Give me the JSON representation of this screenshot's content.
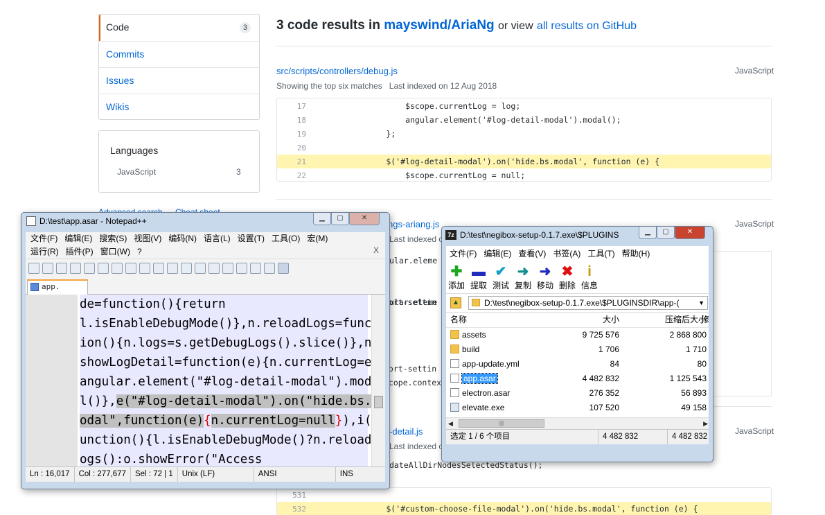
{
  "github": {
    "menu": [
      {
        "label": "Code",
        "count": "3"
      },
      {
        "label": "Commits"
      },
      {
        "label": "Issues"
      },
      {
        "label": "Wikis"
      }
    ],
    "languages_title": "Languages",
    "language": {
      "name": "JavaScript",
      "count": "3"
    },
    "advanced_search": "Advanced search",
    "cheat_sheet": "Cheat sheet",
    "results_heading_prefix": "3 code results in",
    "repo": "mayswind/AriaNg",
    "or_view": "or view",
    "all_results": "all results on GitHub",
    "result1": {
      "path": "src/scripts/controllers/debug.js",
      "lang": "JavaScript",
      "meta": "Showing the top six matches",
      "indexed": "Last indexed on 12 Aug 2018",
      "lines": [
        {
          "n": "17",
          "code": "            $scope.currentLog = log;"
        },
        {
          "n": "18",
          "code": "            angular.element('#log-detail-modal').modal();"
        },
        {
          "n": "19",
          "code": "        };"
        },
        {
          "n": "20",
          "code": ""
        },
        {
          "n": "21",
          "code": "        $('#log-detail-modal').on('hide.bs.modal', function (e) {"
        },
        {
          "n": "22",
          "code": "            $scope.currentLog = null;"
        }
      ]
    },
    "result2": {
      "path_tail": "ngs-ariang.js",
      "lang": "JavaScript",
      "indexed_tail": "Last indexed o"
    },
    "result3": {
      "path_tail": "-detail.js",
      "lang": "JavaScript",
      "indexed_tail": "Last indexed o"
    },
    "behind_fragments": [
      "ular.eleme",
      "port-settin",
      "ular.eleme",
      "port-settin",
      "scope.contex",
      "dateAllDirNodesSelectedStatus();"
    ],
    "bottom_lines": [
      {
        "n": "531",
        "code": ""
      },
      {
        "n": "532",
        "code": "        $('#custom-choose-file-modal').on('hide.bs.modal', function (e) {"
      }
    ]
  },
  "notepad": {
    "title": "D:\\test\\app.asar - Notepad++",
    "menu": [
      "文件(F)",
      "编辑(E)",
      "搜索(S)",
      "视图(V)",
      "编码(N)",
      "语言(L)",
      "设置(T)",
      "工具(O)",
      "宏(M)",
      "运行(R)",
      "插件(P)",
      "窗口(W)",
      "?"
    ],
    "close_x": "X",
    "tab": "app. asar",
    "lines": [
      "de=function(){return",
      "l.isEnableDebugMode()},n.reloadLogs=funct",
      "ion(){n.logs=s.getDebugLogs().slice()},n.",
      "showLogDetail=function(e){n.currentLog=e,",
      "angular.element(\"#log-detail-modal\").moda"
    ],
    "line6_a": "l()},",
    "line6_b": "e(\"#log-detail-modal\").on(\"hide.bs.m",
    "line7_a": "odal\",function(e)",
    "line7_brace1": "{",
    "line7_b": "n.currentLog=null",
    "line7_brace2": "}",
    "line7_c": "),i(f",
    "line8": "unction(){l.isEnableDebugMode()?n.reloadL",
    "line9": "ogs():o.showError(\"Access",
    "status": {
      "ln": "Ln : 16,017",
      "col": "Col : 277,677",
      "sel": "Sel : 72 | 1",
      "eol": "Unix (LF)",
      "enc": "ANSI",
      "mode": "INS"
    }
  },
  "sevenzip": {
    "title": "D:\\test\\negibox-setup-0.1.7.exe\\$PLUGINS...",
    "menu": [
      "文件(F)",
      "编辑(E)",
      "查看(V)",
      "书签(A)",
      "工具(T)",
      "帮助(H)"
    ],
    "toolbar": [
      {
        "label": "添加",
        "icon": "add-icon",
        "glyph": "✚",
        "color": "#1ea61e"
      },
      {
        "label": "提取",
        "icon": "extract-icon",
        "glyph": "▬",
        "color": "#1f2bbd"
      },
      {
        "label": "测试",
        "icon": "test-icon",
        "glyph": "✔",
        "color": "#14a0c8"
      },
      {
        "label": "复制",
        "icon": "copy-icon",
        "glyph": "➜",
        "color": "#148f8f"
      },
      {
        "label": "移动",
        "icon": "move-icon",
        "glyph": "➜",
        "color": "#1f2bbd"
      },
      {
        "label": "删除",
        "icon": "delete-icon",
        "glyph": "✖",
        "color": "#e01010"
      },
      {
        "label": "信息",
        "icon": "info-icon",
        "glyph": "i",
        "color": "#c79a00"
      }
    ],
    "path": "D:\\test\\negibox-setup-0.1.7.exe\\$PLUGINSDIR\\app-(",
    "columns": [
      "名称",
      "大小",
      "压缩后大小",
      "修"
    ],
    "files": [
      {
        "name": "assets",
        "size": "9 725 576",
        "packed": "2 868 800",
        "type": "folder"
      },
      {
        "name": "build",
        "size": "1 706",
        "packed": "1 710",
        "type": "folder"
      },
      {
        "name": "app-update.yml",
        "size": "84",
        "packed": "80",
        "type": "file"
      },
      {
        "name": "app.asar",
        "size": "4 482 832",
        "packed": "1 125 543",
        "type": "file"
      },
      {
        "name": "electron.asar",
        "size": "276 352",
        "packed": "56 893",
        "type": "file"
      },
      {
        "name": "elevate.exe",
        "size": "107 520",
        "packed": "49 158",
        "type": "exe"
      }
    ],
    "status": {
      "selected": "选定 1 / 6 个项目",
      "size": "4 482 832",
      "size2": "4 482 832"
    }
  }
}
